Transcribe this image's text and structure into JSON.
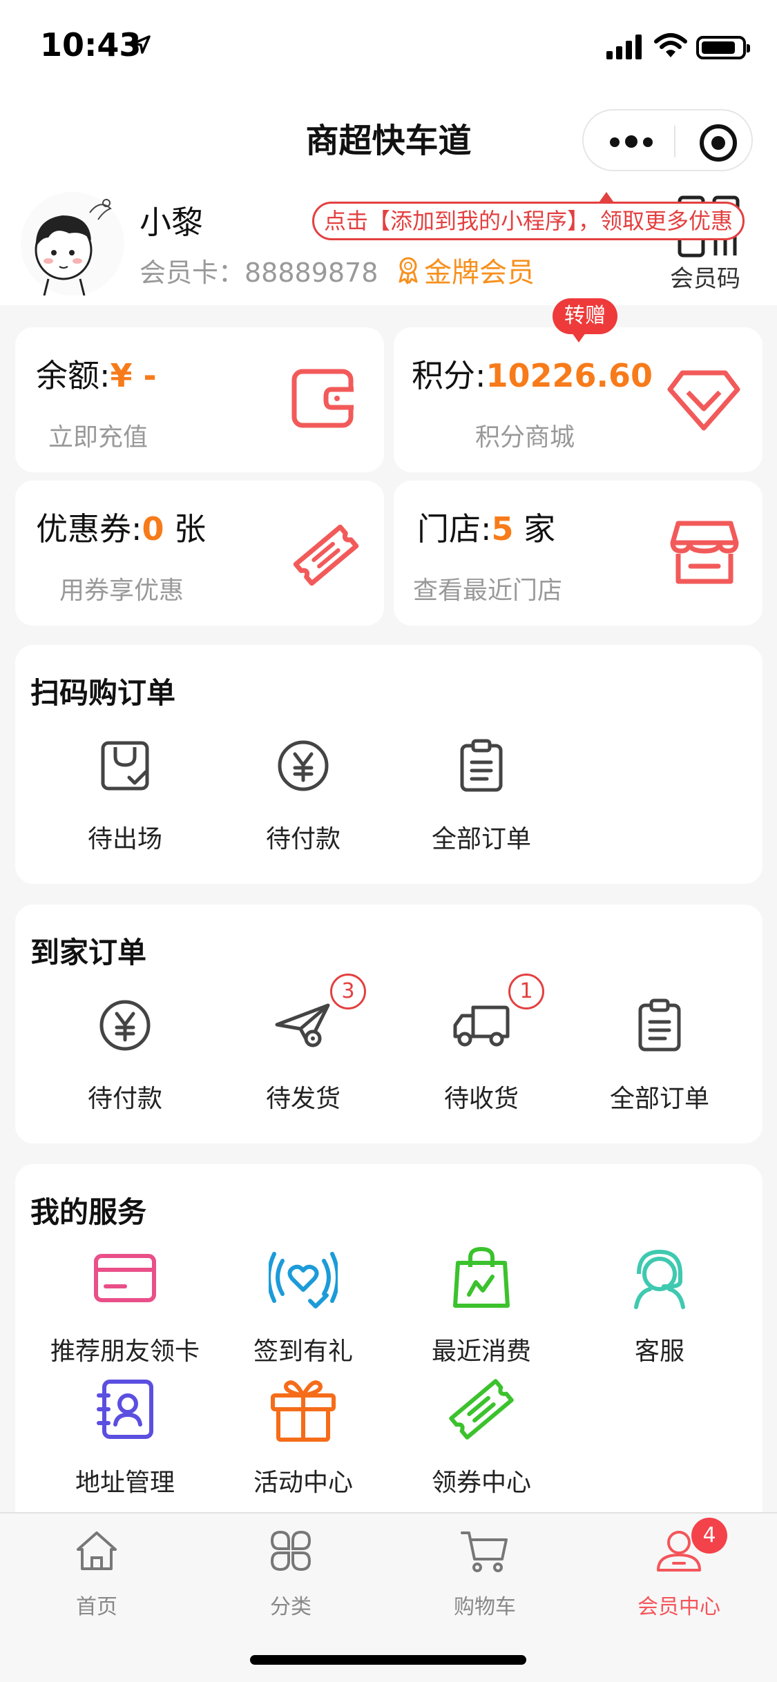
{
  "status_bar": {
    "time": "10:43"
  },
  "navbar": {
    "title": "商超快车道"
  },
  "profile": {
    "name": "小黎",
    "member_card": "会员卡：88889878",
    "level": "金牌会员",
    "tip": "点击【添加到我的小程序】，领取更多优惠",
    "qr_label": "会员码"
  },
  "stats": {
    "balance": {
      "label": "余额:",
      "value": "¥ -",
      "sub": "立即充值"
    },
    "points": {
      "label": "积分:",
      "value": "10226.60",
      "sub": "积分商城",
      "badge": "转赠"
    },
    "coupons": {
      "label": "优惠券:",
      "value": "0",
      "unit": " 张",
      "sub": "用券享优惠"
    },
    "stores": {
      "label": "门店:",
      "value": "5",
      "unit": " 家",
      "sub": "查看最近门店"
    }
  },
  "scan_orders": {
    "title": "扫码购订单",
    "items": [
      {
        "label": "待出场",
        "icon": "bag-check-icon"
      },
      {
        "label": "待付款",
        "icon": "yen-circle-icon"
      },
      {
        "label": "全部订单",
        "icon": "clipboard-icon"
      }
    ]
  },
  "home_orders": {
    "title": "到家订单",
    "items": [
      {
        "label": "待付款",
        "icon": "yen-circle-icon"
      },
      {
        "label": "待发货",
        "icon": "paper-plane-icon",
        "badge": "3"
      },
      {
        "label": "待收货",
        "icon": "truck-icon",
        "badge": "1"
      },
      {
        "label": "全部订单",
        "icon": "clipboard-icon"
      }
    ]
  },
  "services": {
    "title": "我的服务",
    "items": [
      {
        "label": "推荐朋友领卡",
        "icon": "card-icon",
        "color": "#e94f88"
      },
      {
        "label": "签到有礼",
        "icon": "heart-signal-icon",
        "color": "#1c9bd8"
      },
      {
        "label": "最近消费",
        "icon": "shopping-bag-icon",
        "color": "#3bc22d"
      },
      {
        "label": "客服",
        "icon": "headset-icon",
        "color": "#3fc9b0"
      },
      {
        "label": "地址管理",
        "icon": "address-book-icon",
        "color": "#5b4fe0"
      },
      {
        "label": "活动中心",
        "icon": "gift-icon",
        "color": "#f56c19"
      },
      {
        "label": "领券中心",
        "icon": "ticket-icon",
        "color": "#3bc22d"
      }
    ]
  },
  "tabbar": {
    "items": [
      {
        "label": "首页",
        "icon": "home-icon"
      },
      {
        "label": "分类",
        "icon": "category-icon"
      },
      {
        "label": "购物车",
        "icon": "cart-icon"
      },
      {
        "label": "会员中心",
        "icon": "member-icon",
        "badge": "4",
        "active": true
      }
    ]
  },
  "colors": {
    "accent": "#f77b1a",
    "brand_red": "#f25a5a",
    "badge_red": "#e34040"
  }
}
